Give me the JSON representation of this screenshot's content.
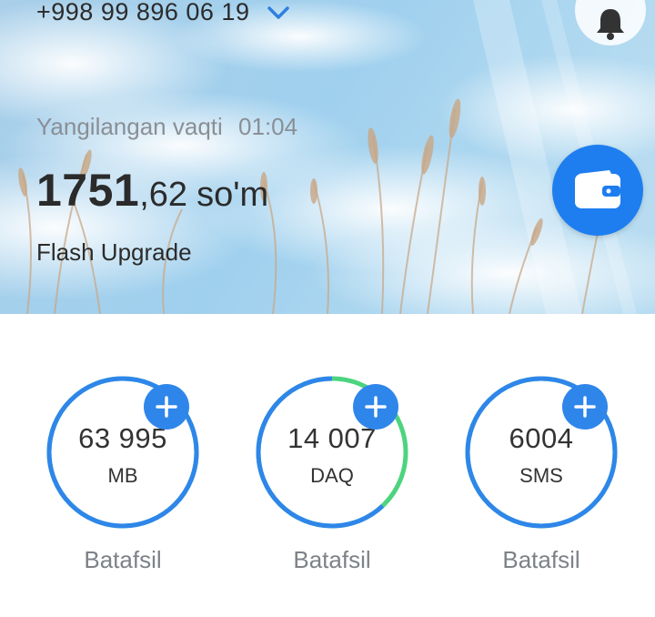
{
  "header": {
    "phone_number": "+998 99 896 06 19",
    "updated_label": "Yangilangan vaqti",
    "updated_time": "01:04",
    "balance_integer": "1751",
    "balance_fraction": ",62",
    "balance_currency": "so'm",
    "tariff_plan": "Flash Upgrade",
    "icons": {
      "dropdown": "chevron-down-icon",
      "notifications": "bell-icon",
      "wallet": "wallet-icon"
    }
  },
  "stats": [
    {
      "value": "63 995",
      "unit": "MB",
      "details_label": "Batafsil",
      "remaining_fraction": 1.0
    },
    {
      "value": "14 007",
      "unit": "DAQ",
      "details_label": "Batafsil",
      "remaining_fraction": 0.62
    },
    {
      "value": "6004",
      "unit": "SMS",
      "details_label": "Batafsil",
      "remaining_fraction": 1.0
    }
  ],
  "colors": {
    "primary_blue": "#2f86ea",
    "wallet_blue": "#1e7ef0",
    "used_green": "#4cd47e",
    "muted_text": "#7d8288"
  }
}
